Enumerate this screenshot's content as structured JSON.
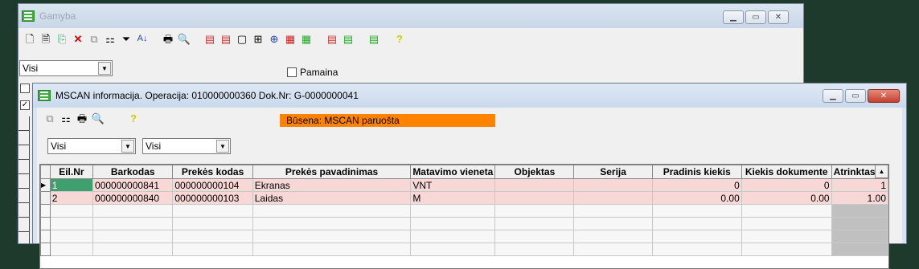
{
  "back_window": {
    "title": "Gamyba",
    "toolbar_icons": [
      "new-doc-icon",
      "doc-icon",
      "copy-icon",
      "delete-icon",
      "copy-file-icon",
      "tree-icon",
      "filter-icon",
      "sort-icon",
      "print-icon",
      "find-icon",
      "import-icon",
      "import2-icon",
      "doc-blank-icon",
      "link-icon",
      "add-row-icon",
      "stack-red-icon",
      "stack-green-icon",
      "stack-icon",
      "stack2-icon",
      "stack3-icon",
      "help-icon"
    ],
    "filter_select": {
      "value": "Visi"
    },
    "pamaina": {
      "label": "Pamaina",
      "checked": false
    }
  },
  "front_window": {
    "title": "MSCAN informacija. Operacija: 010000000360 Dok.Nr: G-0000000041",
    "toolbar_icons": [
      "copy-file-icon",
      "tree-icon",
      "print-icon",
      "find-icon",
      "help-icon"
    ],
    "status": {
      "text": "Būsena: MSCAN paruošta",
      "color": "#ff8200"
    },
    "filter_select_1": {
      "value": "Visi"
    },
    "filter_select_2": {
      "value": "Visi"
    },
    "grid": {
      "columns": [
        "Eil.Nr",
        "Barkodas",
        "Prekės kodas",
        "Prekės pavadinimas",
        "Matavimo vieneta",
        "Objektas",
        "Serija",
        "Pradinis kiekis",
        "Kiekis dokumente",
        "Atrinktas ki"
      ],
      "rows": [
        [
          "1",
          "000000000841",
          "000000000104",
          "Ekranas",
          "VNT",
          "",
          "",
          "0",
          "0",
          "1"
        ],
        [
          "2",
          "000000000840",
          "000000000103",
          "Laidas",
          "M",
          "",
          "",
          "0.00",
          "0.00",
          "1.00"
        ]
      ],
      "row_color": "#f8d7d7"
    }
  }
}
